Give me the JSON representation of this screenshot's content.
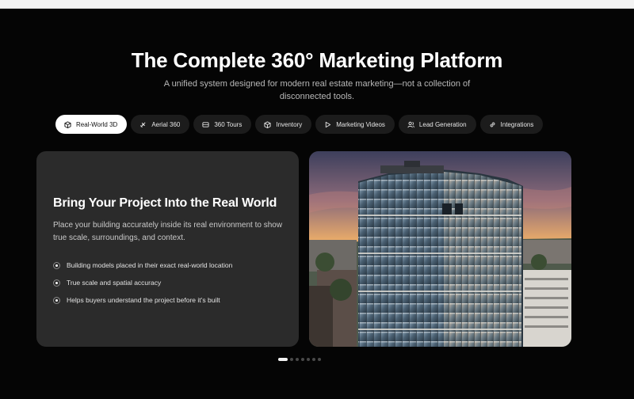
{
  "header": {
    "title": "The Complete 360° Marketing Platform",
    "subtitle": "A unified system designed for modern real estate marketing—not a collection of disconnected tools."
  },
  "tabs": [
    {
      "label": "Real-World 3D",
      "icon": "cube-icon",
      "active": true
    },
    {
      "label": "Aerial 360",
      "icon": "drone-icon",
      "active": false
    },
    {
      "label": "360 Tours",
      "icon": "panorama-icon",
      "active": false
    },
    {
      "label": "Inventory",
      "icon": "box-icon",
      "active": false
    },
    {
      "label": "Marketing Videos",
      "icon": "play-icon",
      "active": false
    },
    {
      "label": "Lead Generation",
      "icon": "users-icon",
      "active": false
    },
    {
      "label": "Integrations",
      "icon": "link-icon",
      "active": false
    }
  ],
  "feature_card": {
    "heading": "Bring Your Project Into the Real World",
    "description": "Place your building accurately inside its real environment to show true scale, surroundings, and context.",
    "features": [
      "Building models placed in their exact real-world location",
      "True scale and spatial accuracy",
      "Helps buyers understand the project before it’s built"
    ],
    "image": "aerial-building-photo"
  },
  "carousel": {
    "slide_count": 7,
    "active_index": 0
  },
  "colors": {
    "background": "#050505",
    "card": "#2b2b2b",
    "active_tab": "#ffffff",
    "inactive_tab": "#1c1c1c"
  }
}
